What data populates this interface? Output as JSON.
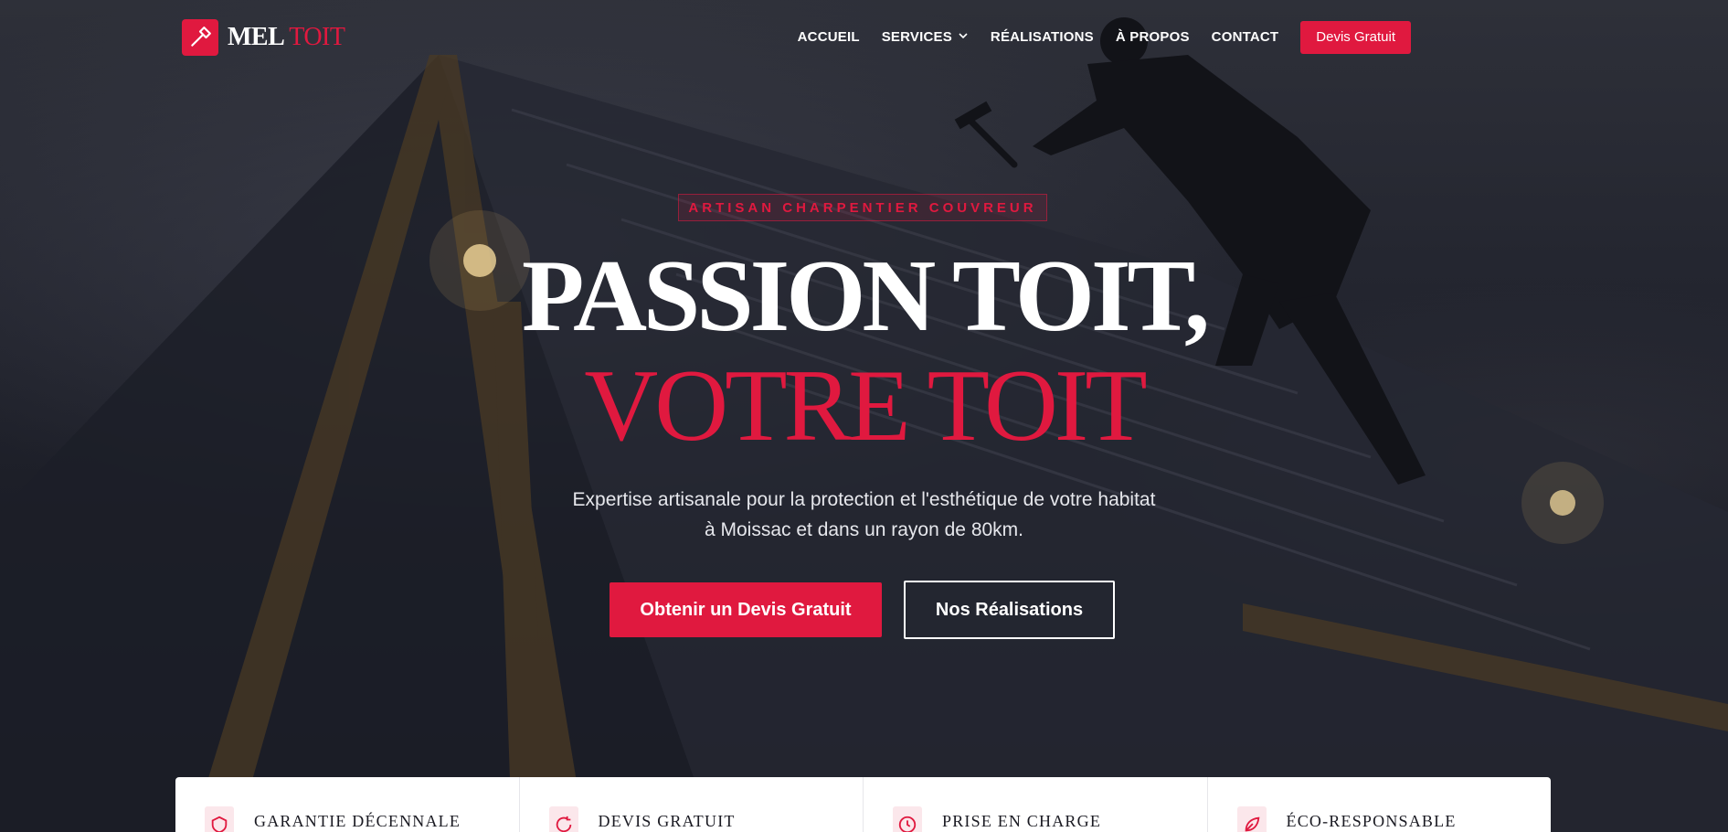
{
  "brand": {
    "name_main": "MEL",
    "name_accent": "TOIT",
    "accent_color": "#e0193f"
  },
  "nav": {
    "items": [
      {
        "label": "ACCUEIL"
      },
      {
        "label": "SERVICES",
        "icon": "chevron-down-icon"
      },
      {
        "label": "RÉALISATIONS"
      },
      {
        "label": "À PROPOS"
      },
      {
        "label": "CONTACT"
      }
    ],
    "cta_label": "Devis Gratuit"
  },
  "hero": {
    "eyebrow": "ARTISAN CHARPENTIER COUVREUR",
    "title_line1": "PASSION TOIT,",
    "title_line2": "VOTRE TOIT",
    "lead_line1": "Expertise artisanale pour la protection et l'esthétique de votre habitat",
    "lead_line2": "à Moissac et dans un rayon de 80km.",
    "primary_button": "Obtenir un Devis Gratuit",
    "secondary_button": "Nos Réalisations"
  },
  "features": [
    {
      "title": "GARANTIE DÉCENNALE",
      "icon": "shield-icon"
    },
    {
      "title": "DEVIS GRATUIT",
      "icon": "refresh-icon"
    },
    {
      "title": "PRISE EN CHARGE",
      "icon": "clock-icon"
    },
    {
      "title": "ÉCO-RESPONSABLE",
      "icon": "leaf-icon"
    }
  ]
}
